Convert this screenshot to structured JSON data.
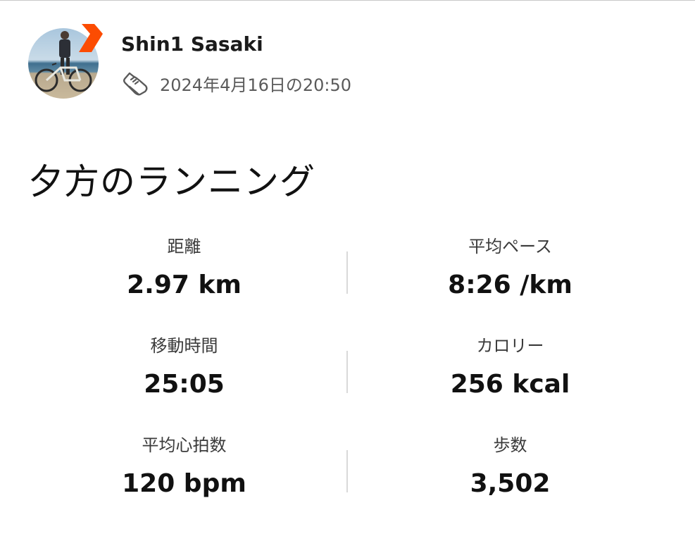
{
  "athlete": {
    "name": "Shin1 Sasaki"
  },
  "activity": {
    "type_icon": "running-shoe-icon",
    "date": "2024年4月16日の20:50",
    "title": "夕方のランニング"
  },
  "stats": [
    {
      "left": {
        "label": "距離",
        "value": "2.97 km"
      },
      "right": {
        "label": "平均ペース",
        "value": "8:26 /km"
      }
    },
    {
      "left": {
        "label": "移動時間",
        "value": "25:05"
      },
      "right": {
        "label": "カロリー",
        "value": "256 kcal"
      }
    },
    {
      "left": {
        "label": "平均心拍数",
        "value": "120 bpm"
      },
      "right": {
        "label": "歩数",
        "value": "3,502"
      }
    }
  ],
  "colors": {
    "brand_orange": "#fc4c02",
    "text_primary": "#111111",
    "text_secondary": "#5a5a5a",
    "divider": "#d9d9d9"
  }
}
